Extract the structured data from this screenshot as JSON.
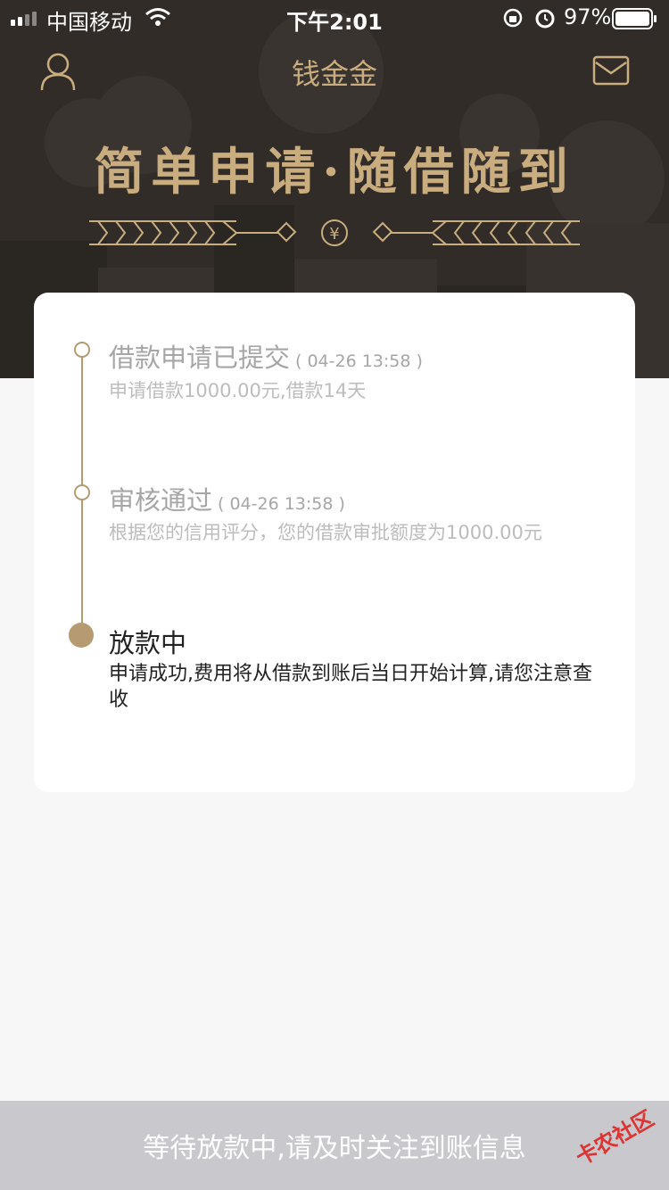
{
  "status_bar": {
    "carrier": "中国移动",
    "time": "下午2:01",
    "battery_percent": "97%"
  },
  "nav": {
    "title": "钱金金"
  },
  "hero": {
    "slogan": "简单申请·随借随到",
    "currency_symbol": "¥"
  },
  "timeline": {
    "steps": [
      {
        "title": "借款申请已提交",
        "time": "( 04-26 13:58 )",
        "desc": "申请借款1000.00元,借款14天"
      },
      {
        "title": "审核通过",
        "time": "( 04-26 13:58 )",
        "desc": "根据您的信用评分，您的借款审批额度为1000.00元"
      },
      {
        "title": "放款中",
        "desc": "申请成功,费用将从借款到账后当日开始计算,请您注意查收"
      }
    ]
  },
  "bottom_bar": {
    "label": "等待放款中,请及时关注到账信息"
  },
  "watermark": {
    "text": "卡农社区"
  },
  "colors": {
    "accent": "#c9ad7f",
    "timeline": "#b59a72",
    "hero_bg": "#312c28"
  }
}
